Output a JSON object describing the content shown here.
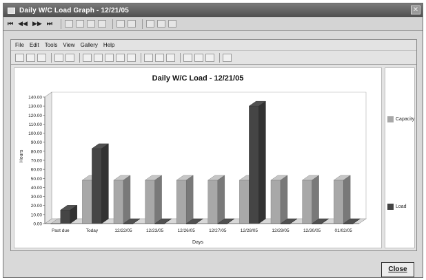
{
  "window": {
    "title": "Daily W/C Load Graph - 12/21/05"
  },
  "navbar": {
    "buttons": [
      "⏮",
      "◀◀",
      "▶▶",
      "⏭"
    ],
    "icons": [
      "record-icon",
      "grid-icon",
      "list-icon",
      "print-icon",
      "edit-icon",
      "filter-icon",
      "graph-icon",
      "people-icon",
      "factory-icon"
    ]
  },
  "menu": {
    "items": [
      "File",
      "Edit",
      "Tools",
      "View",
      "Gallery",
      "Help"
    ]
  },
  "toolbar": {
    "icons": [
      "new-icon",
      "save-icon",
      "open-icon",
      "chart-type-icon",
      "palette-icon",
      "axis-icon",
      "axis-icon",
      "table-icon",
      "grid-icon",
      "legend-icon",
      "3d-icon",
      "rotate-icon",
      "perspective-icon",
      "zoom-icon",
      "copy-icon",
      "properties-icon",
      "tools-icon"
    ]
  },
  "footer": {
    "close_label": "Close"
  },
  "legend": [
    {
      "name": "Capacity",
      "color": "#a8a8a8"
    },
    {
      "name": "Load",
      "color": "#454545"
    }
  ],
  "chart_data": {
    "type": "bar",
    "title": "Daily W/C Load  - 12/21/05",
    "xlabel": "Days",
    "ylabel": "Hours",
    "ylim": [
      0,
      140
    ],
    "yticks": [
      "0.00",
      "10.00",
      "20.00",
      "30.00",
      "40.00",
      "50.00",
      "60.00",
      "70.00",
      "80.00",
      "90.00",
      "100.00",
      "110.00",
      "120.00",
      "130.00",
      "140.00"
    ],
    "categories": [
      "Past due",
      "Today",
      "12/22/05",
      "12/23/05",
      "12/26/05",
      "12/27/05",
      "12/28/05",
      "12/29/05",
      "12/30/05",
      "01/02/05"
    ],
    "series": [
      {
        "name": "Capacity",
        "color": "#a8a8a8",
        "values": [
          0,
          48,
          48,
          48,
          48,
          48,
          48,
          48,
          48,
          48
        ]
      },
      {
        "name": "Load",
        "color": "#454545",
        "values": [
          15,
          83,
          0,
          0,
          0,
          0,
          130,
          0,
          0,
          0
        ]
      }
    ],
    "grid": false,
    "legend": "right"
  }
}
